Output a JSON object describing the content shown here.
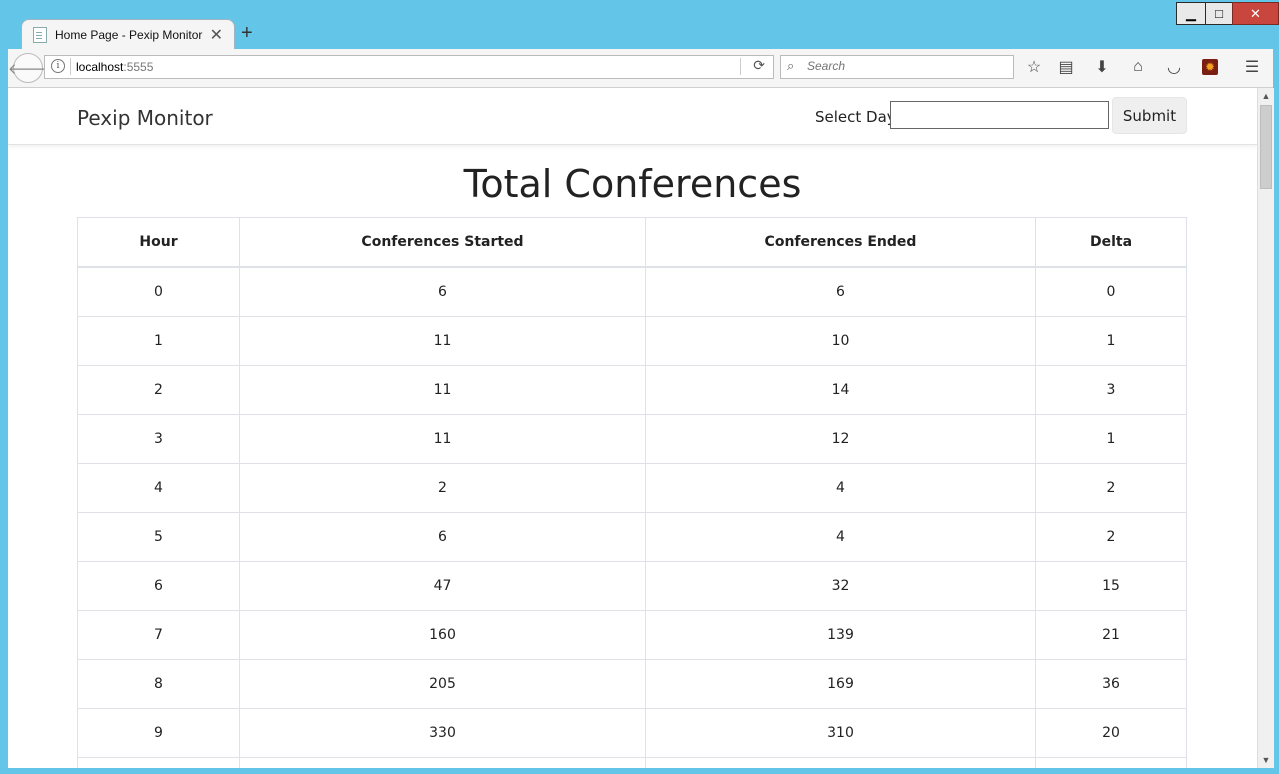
{
  "browser": {
    "tab_title": "Home Page - Pexip Monitor",
    "new_tab": "+",
    "url_host": "localhost",
    "url_port": ":5555",
    "search_placeholder": "Search",
    "window_controls": {
      "minimize": "▁",
      "maximize": "□",
      "close": "✕"
    }
  },
  "site": {
    "brand": "Pexip Monitor",
    "select_day_label": "Select Day:",
    "select_day_value": "",
    "submit_label": "Submit"
  },
  "main": {
    "heading": "Total Conferences",
    "columns": [
      "Hour",
      "Conferences Started",
      "Conferences Ended",
      "Delta"
    ],
    "rows": [
      [
        "0",
        "6",
        "6",
        "0"
      ],
      [
        "1",
        "11",
        "10",
        "1"
      ],
      [
        "2",
        "11",
        "14",
        "3"
      ],
      [
        "3",
        "11",
        "12",
        "1"
      ],
      [
        "4",
        "2",
        "4",
        "2"
      ],
      [
        "5",
        "6",
        "4",
        "2"
      ],
      [
        "6",
        "47",
        "32",
        "15"
      ],
      [
        "7",
        "160",
        "139",
        "21"
      ],
      [
        "8",
        "205",
        "169",
        "36"
      ],
      [
        "9",
        "330",
        "310",
        "20"
      ],
      [
        "",
        "",
        "",
        ""
      ]
    ]
  },
  "icons": [
    "back-icon",
    "info-icon",
    "reload-icon",
    "search-icon",
    "bookmark-star-icon",
    "reader-icon",
    "download-icon",
    "home-icon",
    "pocket-icon",
    "addon-icon",
    "menu-icon"
  ],
  "colors": {
    "window_frame": "#63c6e8",
    "close_button": "#c8463d"
  }
}
